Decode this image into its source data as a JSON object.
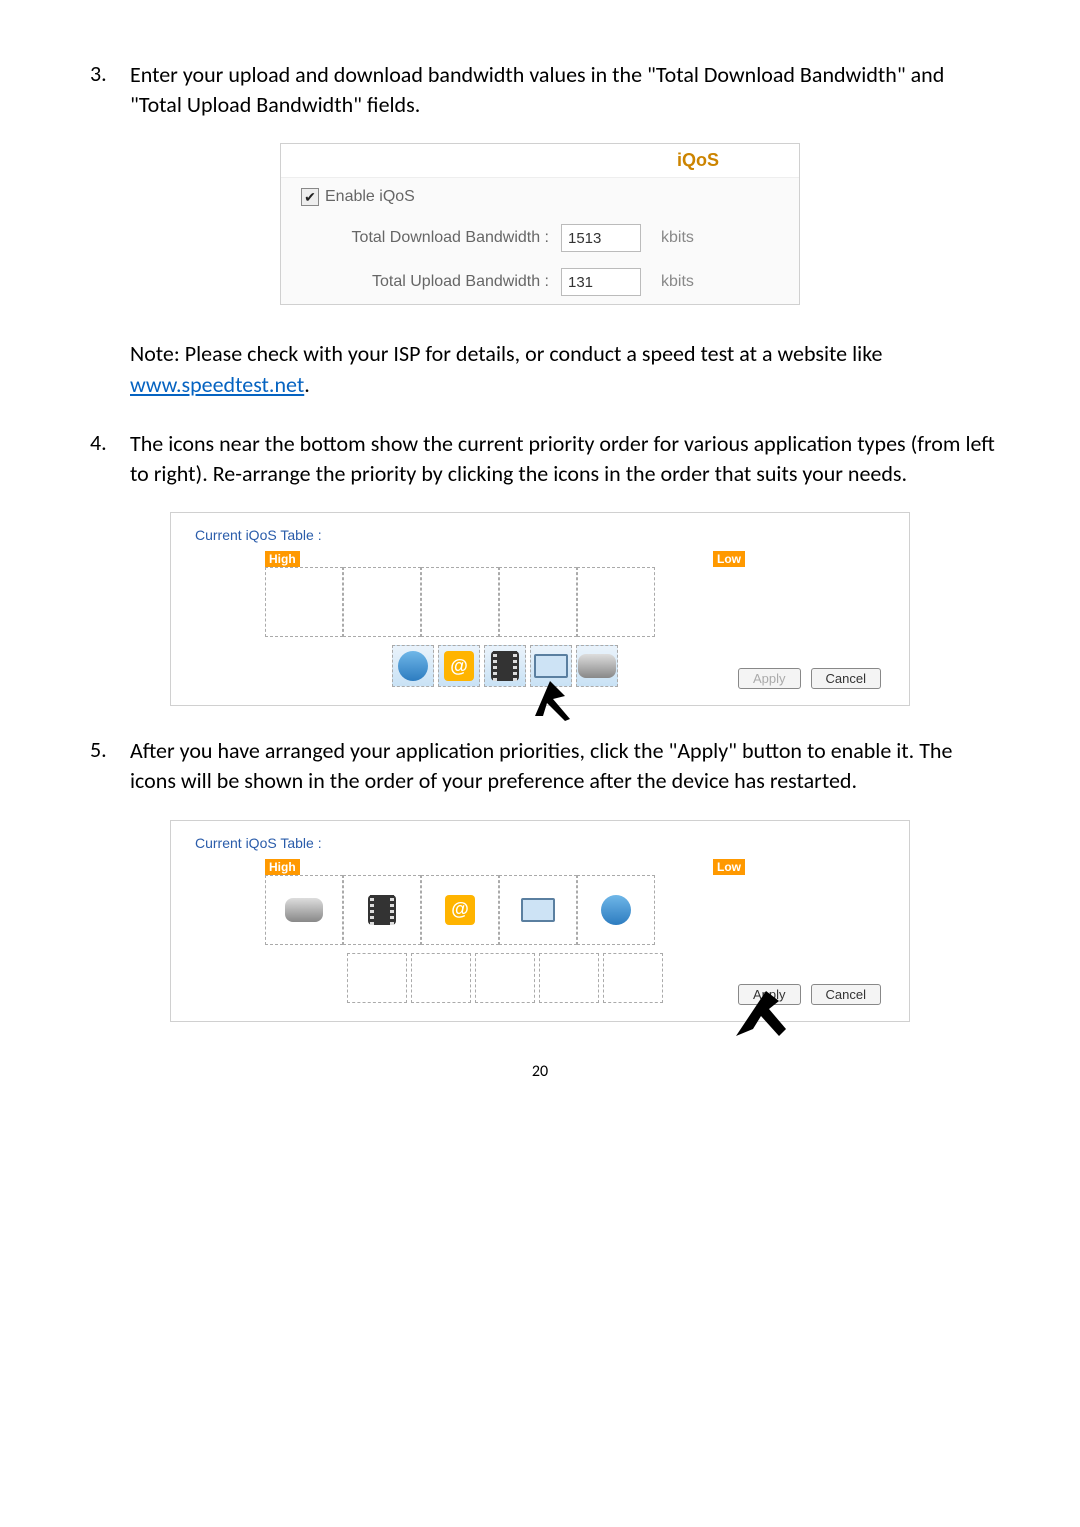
{
  "step3": {
    "num": "3.",
    "text": "Enter your upload and download bandwidth values in the \"Total Download Bandwidth\" and \"Total Upload Bandwidth\" fields."
  },
  "iqos_panel": {
    "title": "iQoS",
    "enable_label": "Enable iQoS",
    "download_label": "Total Download Bandwidth :",
    "download_value": "1513",
    "upload_label": "Total Upload Bandwidth :",
    "upload_value": "131",
    "unit": "kbits"
  },
  "note": {
    "prefix": "Note: Please check with your ISP for details, or conduct a speed test at a website like ",
    "link_text": "www.speedtest.net",
    "link_href": "http://www.speedtest.net",
    "suffix": "."
  },
  "step4": {
    "num": "4.",
    "text": "The icons near the bottom show the current priority order for various application types (from left to right). Re-arrange the priority by clicking the icons in the order that suits your needs."
  },
  "table": {
    "label": "Current iQoS Table :",
    "high": "High",
    "low": "Low",
    "apply": "Apply",
    "cancel": "Cancel"
  },
  "step5": {
    "num": "5.",
    "text": "After you have arranged your application priorities, click the \"Apply\" button to enable it. The icons will be shown in the order of your preference after the device has restarted."
  },
  "page_number": "20",
  "icon_names": [
    "globe-icon",
    "at-icon",
    "film-icon",
    "pc-icon",
    "game-icon"
  ]
}
